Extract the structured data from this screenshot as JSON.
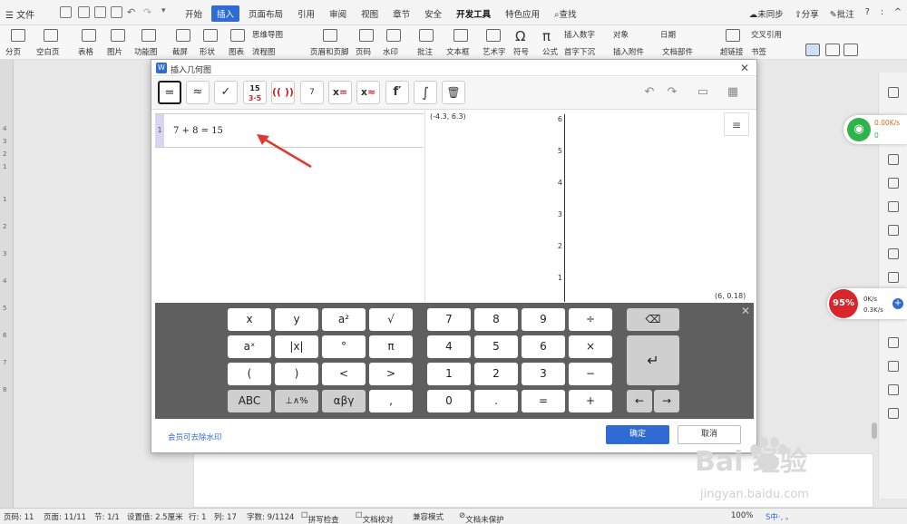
{
  "menubar": {
    "file_label": "文件",
    "tabs": [
      "开始",
      "插入",
      "页面布局",
      "引用",
      "审阅",
      "视图",
      "章节",
      "安全",
      "开发工具",
      "特色应用"
    ],
    "active_tab": "插入",
    "search_label": "查找",
    "sync_label": "未同步",
    "share_label": "分享",
    "comment_label": "批注"
  },
  "ribbon": {
    "items": [
      "分页",
      "空白页",
      "表格",
      "图片",
      "功能图",
      "截屏",
      "形状",
      "图表",
      "思维导图",
      "流程图",
      "页眉和页脚",
      "页码",
      "水印",
      "批注",
      "文本框",
      "艺术字",
      "符号",
      "公式",
      "插入数字",
      "对象",
      "日期",
      "首字下沉",
      "插入附件",
      "文档部件",
      "超链接",
      "交叉引用",
      "书签"
    ]
  },
  "dialog": {
    "title": "插入几何图",
    "toolbar_buttons": [
      {
        "label": "=",
        "name": "equals-tool"
      },
      {
        "label": "≈",
        "name": "approx-tool"
      },
      {
        "label": "✓",
        "name": "check-tool"
      },
      {
        "label": "15 3·5",
        "name": "fraction-tool"
      },
      {
        "label": "(( ))",
        "name": "paren-tool"
      },
      {
        "label": "7",
        "name": "point-tool"
      },
      {
        "label": "x=",
        "name": "x-equals-tool"
      },
      {
        "label": "x≈",
        "name": "x-approx-tool"
      },
      {
        "label": "f′",
        "name": "derivative-tool"
      },
      {
        "label": "∫",
        "name": "integral-tool"
      }
    ],
    "algebra": {
      "row_number": "1",
      "expression": "7 + 8 = 15"
    },
    "graph": {
      "top_left_coord": "(-4.3, 6.3)",
      "bottom_right_coord": "(6, 0.18)",
      "y_ticks": [
        "6",
        "5",
        "4",
        "3",
        "2",
        "1"
      ]
    },
    "keyboard": {
      "left_keys": [
        "x",
        "y",
        "a²",
        "√",
        "aˣ",
        "|x|",
        "°",
        "π",
        "(",
        ")",
        "<",
        ">",
        "ABC",
        "⊥∧%",
        "αβγ",
        ","
      ],
      "right_keys": [
        "7",
        "8",
        "9",
        "÷",
        "4",
        "5",
        "6",
        "×",
        "1",
        "2",
        "3",
        "−",
        "0",
        ".",
        "=",
        "+"
      ],
      "backspace": "⌫",
      "enter": "↵",
      "left_arrow": "←",
      "right_arrow": "→"
    },
    "footer": {
      "member_note": "会员可去除水印",
      "ok_label": "确定",
      "cancel_label": "取消"
    }
  },
  "status": {
    "page_code": "页码: 11",
    "page": "页面: 11/11",
    "section": "节: 1/1",
    "setting": "设置值: 2.5厘米",
    "row": "行: 1",
    "col": "列: 17",
    "word_count": "字数: 9/1124",
    "spell": "拼写检查",
    "proof": "文档校对",
    "compat": "兼容模式",
    "protect": "文档未保护",
    "zoom": "100%"
  },
  "widgets": {
    "net_up": "0.00K/s",
    "net_down": "0",
    "pct": "95%",
    "speed_up": "0K/s",
    "speed_down": "0.3K/s"
  },
  "watermark": {
    "brand": "Bai 经验",
    "url": "jingyan.baidu.com"
  },
  "colors": {
    "accent": "#2f6bd2",
    "keyboard_bg": "#5f5f5f",
    "algebra_marker": "#d9d4f2",
    "arrow": "#e03a2f"
  }
}
